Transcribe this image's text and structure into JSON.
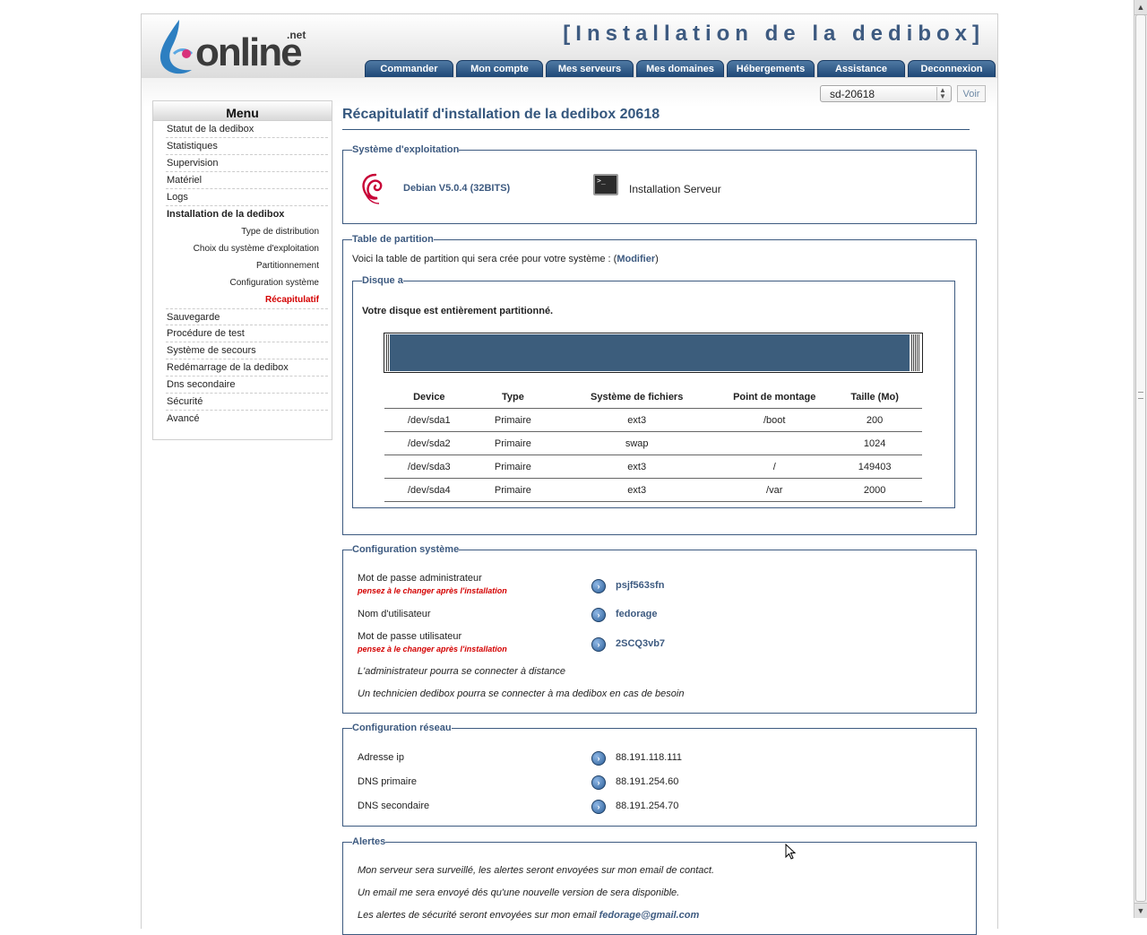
{
  "header": {
    "title": "[Installation de la dedibox]",
    "logo_text": "online",
    "logo_suffix": ".net"
  },
  "tabs": [
    "Commander",
    "Mon compte",
    "Mes serveurs",
    "Mes domaines",
    "Hébergements",
    "Assistance",
    "Deconnexion"
  ],
  "server_selector": {
    "value": "sd-20618",
    "button": "Voir"
  },
  "sidebar": {
    "title": "Menu",
    "items": [
      "Statut de la dedibox",
      "Statistiques",
      "Supervision",
      "Matériel",
      "Logs",
      "Installation de la dedibox"
    ],
    "subitems": [
      "Type de distribution",
      "Choix du système d'exploitation",
      "Partitionnement",
      "Configuration système",
      "Récapitulatif"
    ],
    "items_after": [
      "Sauvegarde",
      "Procédure de test",
      "Système de secours",
      "Redémarrage de la dedibox",
      "Dns secondaire",
      "Sécurité",
      "Avancé"
    ]
  },
  "page_title": "Récapitulatif d'installation de la dedibox 20618",
  "os_section": {
    "legend": "Système d'exploitation",
    "os_name": "Debian V5.0.4 (32BITS)",
    "install_type": "Installation Serveur",
    "terminal_prompt": ">_"
  },
  "partition_section": {
    "legend": "Table de partition",
    "intro": "Voici la table de partition qui sera crée pour votre système : (",
    "modify_link": "Modifier",
    "intro_end": ")",
    "disk_legend": "Disque a",
    "disk_message": "Votre disque est entièrement partitionné.",
    "columns": [
      "Device",
      "Type",
      "Système de fichiers",
      "Point de montage",
      "Taille (Mo)"
    ],
    "rows": [
      [
        "/dev/sda1",
        "Primaire",
        "ext3",
        "/boot",
        "200"
      ],
      [
        "/dev/sda2",
        "Primaire",
        "swap",
        "",
        "1024"
      ],
      [
        "/dev/sda3",
        "Primaire",
        "ext3",
        "/",
        "149403"
      ],
      [
        "/dev/sda4",
        "Primaire",
        "ext3",
        "/var",
        "2000"
      ]
    ]
  },
  "system_config": {
    "legend": "Configuration système",
    "admin_password_label": "Mot de passe administrateur",
    "admin_password_warning": "pensez à le changer après l'installation",
    "admin_password": "psjf563sfn",
    "username_label": "Nom d'utilisateur",
    "username": "fedorage",
    "user_password_label": "Mot de passe utilisateur",
    "user_password_warning": "pensez à le changer après l'installation",
    "user_password": "2SCQ3vb7",
    "remote_admin_note": "L'administrateur pourra se connecter à distance",
    "technician_note": "Un technicien dedibox pourra se connecter à ma dedibox en cas de besoin"
  },
  "network_config": {
    "legend": "Configuration réseau",
    "ip_label": "Adresse ip",
    "ip": "88.191.118.111",
    "dns1_label": "DNS primaire",
    "dns1": "88.191.254.60",
    "dns2_label": "DNS secondaire",
    "dns2": "88.191.254.70"
  },
  "alerts": {
    "legend": "Alertes",
    "line1": "Mon serveur sera surveillé, les alertes seront envoyées sur mon email de contact.",
    "line2": "Un email me sera envoyé dés qu'une nouvelle version de sera disponible.",
    "line3": "Les alertes de sécurité seront envoyées sur mon email ",
    "email": "fedorage@gmail.com"
  },
  "colors": {
    "accent": "#3d5a80",
    "tab": "#2a5686",
    "warning": "#d40000",
    "disk_bar": "#3c5d7c"
  }
}
